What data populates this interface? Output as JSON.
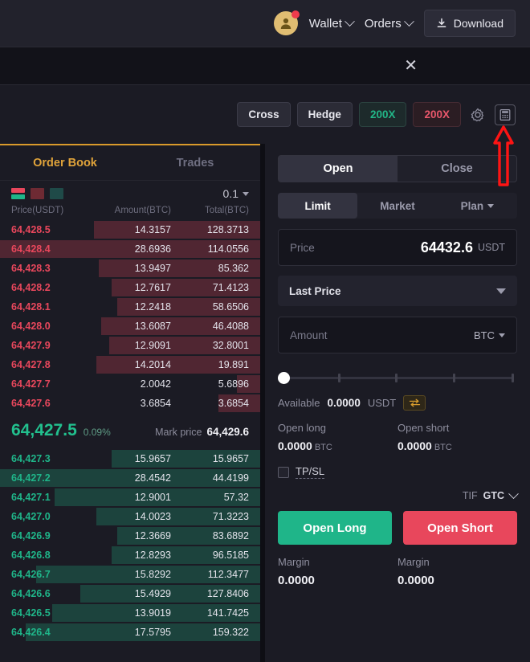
{
  "topnav": {
    "wallet_label": "Wallet",
    "orders_label": "Orders",
    "download_label": "Download"
  },
  "banner": {
    "close_label": "✕"
  },
  "controls": {
    "margin_mode": "Cross",
    "position_mode": "Hedge",
    "leverage_long": "200X",
    "leverage_short": "200X"
  },
  "orderbook": {
    "tabs": [
      {
        "label": "Order Book",
        "active": true
      },
      {
        "label": "Trades",
        "active": false
      }
    ],
    "tick_size": "0.1",
    "headers": {
      "price": "Price(USDT)",
      "amount": "Amount(BTC)",
      "total": "Total(BTC)"
    },
    "asks": [
      {
        "price": "64,428.5",
        "amount": "14.3157",
        "total": "128.3713",
        "depth": 64
      },
      {
        "price": "64,428.4",
        "amount": "28.6936",
        "total": "114.0556",
        "depth": 100
      },
      {
        "price": "64,428.3",
        "amount": "13.9497",
        "total": "85.362",
        "depth": 62
      },
      {
        "price": "64,428.2",
        "amount": "12.7617",
        "total": "71.4123",
        "depth": 57
      },
      {
        "price": "64,428.1",
        "amount": "12.2418",
        "total": "58.6506",
        "depth": 55
      },
      {
        "price": "64,428.0",
        "amount": "13.6087",
        "total": "46.4088",
        "depth": 61
      },
      {
        "price": "64,427.9",
        "amount": "12.9091",
        "total": "32.8001",
        "depth": 58
      },
      {
        "price": "64,427.8",
        "amount": "14.2014",
        "total": "19.891",
        "depth": 63
      },
      {
        "price": "64,427.7",
        "amount": "2.0042",
        "total": "5.6896",
        "depth": 9
      },
      {
        "price": "64,427.6",
        "amount": "3.6854",
        "total": "3.6854",
        "depth": 16
      }
    ],
    "mid": {
      "last_price": "64,427.5",
      "change_pct": "0.09%",
      "mark_label": "Mark price",
      "mark_price": "64,429.6"
    },
    "bids": [
      {
        "price": "64,427.3",
        "amount": "15.9657",
        "total": "15.9657",
        "depth": 57
      },
      {
        "price": "64,427.2",
        "amount": "28.4542",
        "total": "44.4199",
        "depth": 100
      },
      {
        "price": "64,427.1",
        "amount": "12.9001",
        "total": "57.32",
        "depth": 79
      },
      {
        "price": "64,427.0",
        "amount": "14.0023",
        "total": "71.3223",
        "depth": 63
      },
      {
        "price": "64,426.9",
        "amount": "12.3669",
        "total": "83.6892",
        "depth": 55
      },
      {
        "price": "64,426.8",
        "amount": "12.8293",
        "total": "96.5185",
        "depth": 57
      },
      {
        "price": "64,426.7",
        "amount": "15.8292",
        "total": "112.3477",
        "depth": 86
      },
      {
        "price": "64,426.6",
        "amount": "15.4929",
        "total": "127.8406",
        "depth": 69
      },
      {
        "price": "64,426.5",
        "amount": "13.9019",
        "total": "141.7425",
        "depth": 80
      },
      {
        "price": "64,426.4",
        "amount": "17.5795",
        "total": "159.322",
        "depth": 90
      }
    ]
  },
  "trade": {
    "direction_tabs": [
      {
        "label": "Open",
        "active": true
      },
      {
        "label": "Close",
        "active": false
      }
    ],
    "order_types": [
      {
        "label": "Limit",
        "active": true
      },
      {
        "label": "Market",
        "active": false
      },
      {
        "label": "Plan",
        "active": false
      }
    ],
    "price": {
      "label": "Price",
      "value": "64432.6",
      "unit": "USDT"
    },
    "trigger_type": "Last Price",
    "amount": {
      "placeholder": "Amount",
      "value": "",
      "unit": "BTC"
    },
    "slider_percent": 0,
    "available": {
      "label": "Available",
      "value": "0.0000",
      "unit": "USDT"
    },
    "open_long": {
      "label": "Open long",
      "value": "0.0000",
      "unit": "BTC"
    },
    "open_short": {
      "label": "Open short",
      "value": "0.0000",
      "unit": "BTC"
    },
    "tpsl_label": "TP/SL",
    "tif_label": "TIF",
    "tif_value": "GTC",
    "btn_long": "Open Long",
    "btn_short": "Open Short",
    "margin_long": {
      "label": "Margin",
      "value": "0.0000"
    },
    "margin_short": {
      "label": "Margin",
      "value": "0.0000"
    }
  },
  "colors": {
    "ask_red": "#e8475c",
    "bid_green": "#1fb589",
    "accent_gold": "#e0a33a",
    "annotation_red": "#fd1414"
  }
}
